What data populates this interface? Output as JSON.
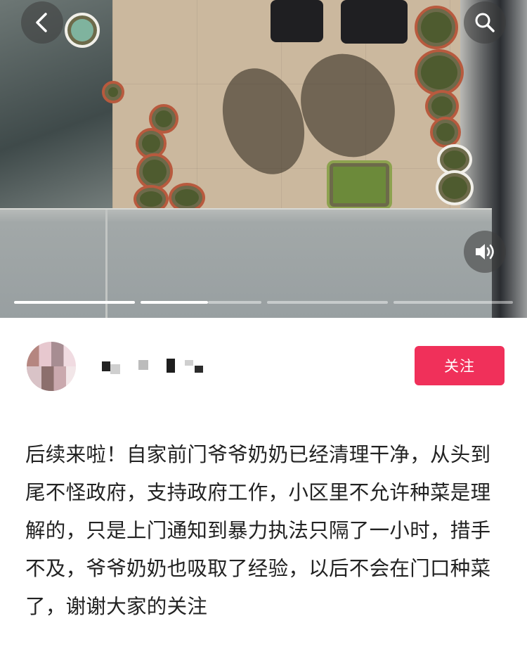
{
  "media": {
    "description_icons": [
      "back-icon",
      "search-icon",
      "volume-icon"
    ],
    "progress_segments": 4,
    "active_segment": 1,
    "accent": "#f0305a"
  },
  "author": {
    "follow_label": "关注"
  },
  "post": {
    "caption": "后续来啦！自家前门爷爷奶奶已经清理干净，从头到尾不怪政府，支持政府工作，小区里不允许种菜是理解的，只是上门通知到暴力执法只隔了一小时，措手不及，爷爷奶奶也吸取了经验，以后不会在门口种菜了，谢谢大家的关注"
  }
}
